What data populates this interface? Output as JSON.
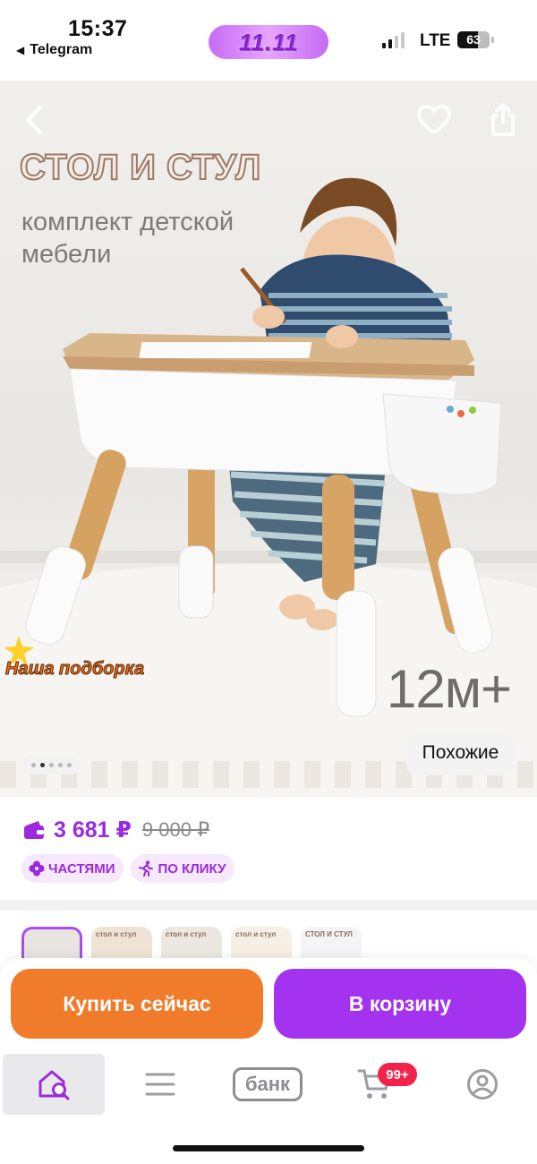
{
  "status_bar": {
    "time": "15:37",
    "back_app": "Telegram",
    "promo": "11.11",
    "network": "LTE",
    "battery": "63",
    "battery_level": 0.63
  },
  "hero": {
    "title": "СТОЛ И СТУЛ",
    "subtitle": "комплект детской мебели",
    "age": "12м+",
    "collection_label": "Наша подборка",
    "similar_button": "Похожие",
    "page_dots_total": 5,
    "page_dots_active": 2
  },
  "product": {
    "price": "3 681 ₽",
    "old_price": "9 000 ₽",
    "badges": {
      "installments": "ЧАСТЯМИ",
      "one_click": "ПО КЛИКУ"
    }
  },
  "thumbnails": [
    {
      "label": ""
    },
    {
      "label": "стол и стул"
    },
    {
      "label": "стол и стул"
    },
    {
      "label": "стол и стул"
    },
    {
      "label": "СТОЛ И СТУЛ"
    }
  ],
  "actions": {
    "buy_now": "Купить сейчас",
    "add_to_cart": "В корзину"
  },
  "tabbar": {
    "bank": "банк",
    "cart_count": "99+"
  },
  "colors": {
    "accent_purple": "#a433ef",
    "price_purple": "#9a2bdc",
    "buy_orange": "#f07c2b",
    "badge_red": "#f3224a"
  }
}
